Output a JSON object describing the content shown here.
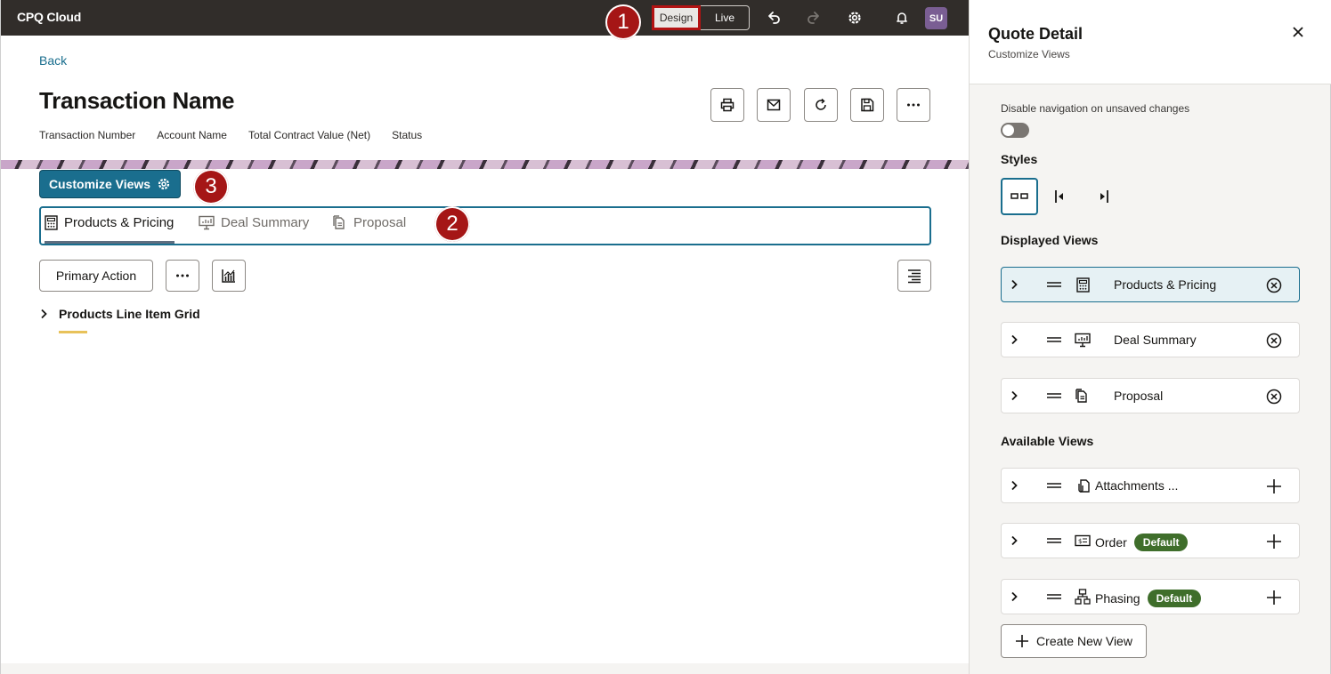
{
  "topbar": {
    "app_title": "CPQ Cloud",
    "design_label": "Design",
    "live_label": "Live",
    "user_initials": "SU"
  },
  "callouts": [
    "1",
    "2",
    "3"
  ],
  "header": {
    "back_label": "Back",
    "title": "Transaction Name",
    "meta": [
      "Transaction Number",
      "Account Name",
      "Total Contract Value (Net)",
      "Status"
    ]
  },
  "customize_label": "Customize Views",
  "tabs": [
    {
      "label": "Products & Pricing",
      "icon": "calculator-icon"
    },
    {
      "label": "Deal Summary",
      "icon": "presentation-chart-icon"
    },
    {
      "label": "Proposal",
      "icon": "document-icon"
    }
  ],
  "toolbar": {
    "primary_action_label": "Primary Action"
  },
  "grid": {
    "title": "Products Line Item Grid"
  },
  "panel": {
    "title": "Quote Detail",
    "subtitle": "Customize Views",
    "disable_nav_label": "Disable navigation on unsaved changes",
    "styles_heading": "Styles",
    "displayed_heading": "Displayed Views",
    "available_heading": "Available Views",
    "displayed_views": [
      {
        "label": "Products & Pricing",
        "icon": "calculator-icon"
      },
      {
        "label": "Deal Summary",
        "icon": "presentation-chart-icon"
      },
      {
        "label": "Proposal",
        "icon": "document-icon"
      }
    ],
    "available_views": [
      {
        "label": "Attachments ...",
        "icon": "attachment-icon",
        "badge": ""
      },
      {
        "label": "Order",
        "icon": "invoice-icon",
        "badge": "Default"
      },
      {
        "label": "Phasing",
        "icon": "hierarchy-icon",
        "badge": "Default"
      }
    ],
    "create_label": "Create New View"
  },
  "colors": {
    "topbar": "#312d2a",
    "accent": "#1a6e8e",
    "callout": "#a51616",
    "badge": "#3f6e2b"
  }
}
